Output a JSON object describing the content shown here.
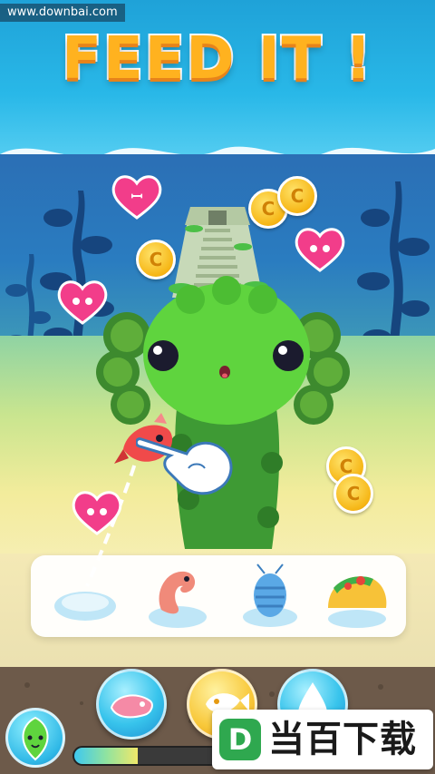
{
  "watermark_top": "www.downbai.com",
  "title": "FEED IT !",
  "food_tray": {
    "items": [
      {
        "name": "empty-dish-icon"
      },
      {
        "name": "shrimp-icon"
      },
      {
        "name": "isopod-icon"
      },
      {
        "name": "taco-icon"
      }
    ]
  },
  "bottom_bar": {
    "buttons": [
      {
        "name": "leaf-icon"
      },
      {
        "name": "fish-food-icon"
      },
      {
        "name": "fish-icon"
      },
      {
        "name": "water-drop-icon"
      }
    ],
    "growth_progress": 0.42
  },
  "brand": {
    "logo_letter": "D",
    "text": "当百下载"
  },
  "colors": {
    "title": "#ffb21f",
    "heart": "#f23d8a",
    "coin": "#f6b616",
    "creature": "#5fd43e"
  }
}
